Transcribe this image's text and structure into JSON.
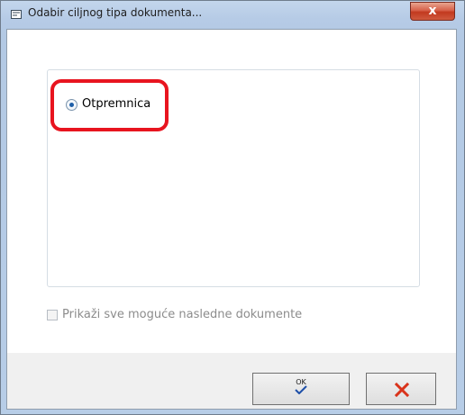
{
  "window": {
    "title": "Odabir ciljnog tipa dokumenta...",
    "close_label": "x"
  },
  "options": {
    "selected_label": "Otpremnica"
  },
  "checkbox": {
    "label": "Prikaži sve moguće nasledne dokumente",
    "checked": false
  },
  "buttons": {
    "ok_label": "OK",
    "ok_icon": "checkmark-icon",
    "cancel_icon": "close-x-icon"
  },
  "colors": {
    "highlight": "#e8141f",
    "cancel_x": "#d9331b",
    "ok_check": "#1e4fa8"
  }
}
